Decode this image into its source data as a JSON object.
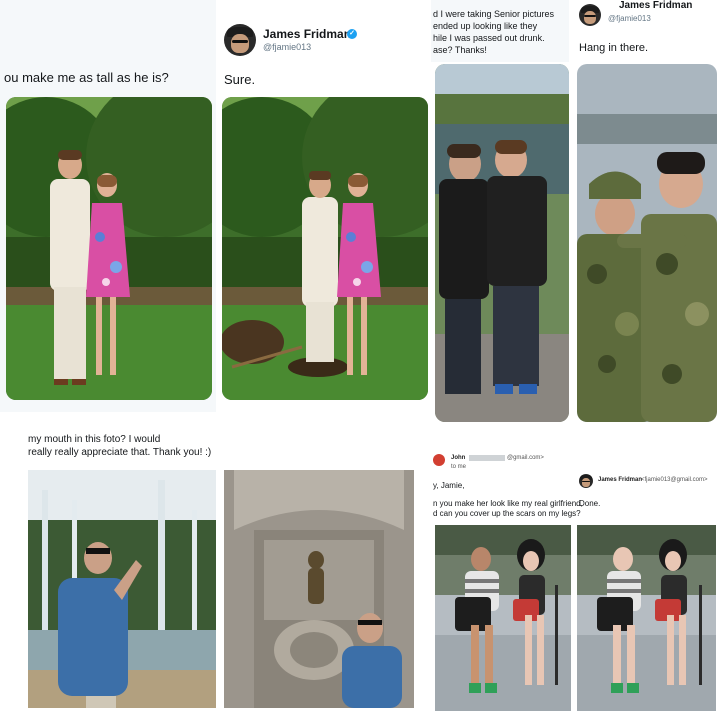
{
  "collage": {
    "panel1": {
      "left_request": "ou make me as tall as he is?",
      "right_reply": "Sure.",
      "author_name": "James Fridman",
      "author_handle": "@fjamie013",
      "verified_mark": "✓",
      "colors": {
        "grass": "#3f7d2a",
        "bush": "#2e5a1f",
        "dress": "#d94fa4",
        "suit": "#eee9df"
      }
    },
    "panel2": {
      "request_line1": "d I were taking Senior pictures",
      "request_line2": "ended up looking like they",
      "request_line3": "hile I was passed out drunk.",
      "request_line4": "ase? Thanks!",
      "author_name": "James Fridman",
      "author_handle": "@fjamie013",
      "reply": "Hang in there.",
      "colors": {
        "camo": "#5d6b3c",
        "pond": "#4f6a6e",
        "shirt": "#1e1e1e"
      }
    },
    "panel3": {
      "request_line1": "my mouth in this foto? I would",
      "request_line2": "really really appreciate that. Thank you! :)",
      "colors": {
        "jacket": "#3c6fa8",
        "fountain": "#d8e4ea",
        "stone": "#9b958c"
      }
    },
    "panel4": {
      "sender_name": "John",
      "sender_email": "@gmail.com>",
      "to_me": "to me",
      "greeting": "y, Jamie,",
      "request_line1": "n you make her look like my real girlfriend,",
      "request_line2": "d can you cover up the scars on my legs?",
      "reply_name": "James Fridman",
      "reply_email": "<fjamie013@gmail.com>",
      "reply": "Done.",
      "colors": {
        "chair": "#2b2b2b",
        "mannequin": "#e8c6b4",
        "bag": "#c43a36"
      }
    }
  }
}
